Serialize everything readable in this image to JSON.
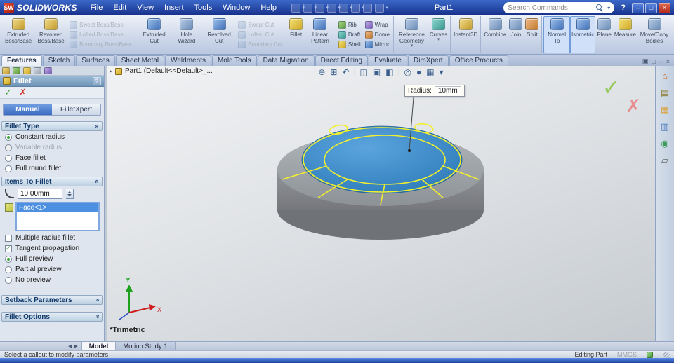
{
  "colors": {
    "tb1": "#3b68c8",
    "tb2": "#17308a",
    "ribbon1": "#eef2f8",
    "ribbon2": "#b9c7e0",
    "tabbg": "#c0cce2",
    "pmh1": "#9cbcd6",
    "pmh2": "#6d93b6",
    "sel": "#4d8fe0",
    "vp1": "#f1f2f4",
    "vp2": "#c6cbd0",
    "model-blue": "#3387c7",
    "edge-yellow": "#f2ef2d",
    "model-gray": "#9aa0a5",
    "ok-green": "#86c440",
    "cancel-red": "#e87a7a",
    "strip1": "#5b8ee8",
    "strip2": "#1d3f9e"
  },
  "titlebar": {
    "app_name": "SOLIDWORKS",
    "menus": [
      "File",
      "Edit",
      "View",
      "Insert",
      "Tools",
      "Window",
      "Help"
    ],
    "doc_title": "Part1",
    "search_placeholder": "Search Commands",
    "help_icon": "?",
    "window_icons": {
      "minimize": "–",
      "maximize": "□",
      "close": "×"
    }
  },
  "ribbon": {
    "groups": [
      {
        "buttons": [
          {
            "label": "Extruded Boss/Base"
          },
          {
            "label": "Revolved Boss/Base"
          },
          {
            "label": "Swept Boss/Base"
          },
          {
            "label": "Lofted Boss/Base"
          },
          {
            "label": "Boundary Boss/Base"
          }
        ]
      },
      {
        "buttons": [
          {
            "label": "Extruded Cut"
          },
          {
            "label": "Hole Wizard"
          },
          {
            "label": "Revolved Cut"
          },
          {
            "label": "Swept Cut"
          },
          {
            "label": "Lofted Cut"
          },
          {
            "label": "Boundary Cut"
          }
        ]
      },
      {
        "buttons": [
          {
            "label": "Fillet"
          },
          {
            "label": "Linear Pattern"
          },
          {
            "label": "Rib"
          },
          {
            "label": "Draft"
          },
          {
            "label": "Shell"
          },
          {
            "label": "Wrap"
          },
          {
            "label": "Dome"
          },
          {
            "label": "Mirror"
          }
        ]
      },
      {
        "buttons": [
          {
            "label": "Reference Geometry"
          },
          {
            "label": "Curves"
          }
        ]
      },
      {
        "buttons": [
          {
            "label": "Instant3D"
          }
        ]
      },
      {
        "buttons": [
          {
            "label": "Combine"
          },
          {
            "label": "Join"
          },
          {
            "label": "Split"
          }
        ]
      },
      {
        "buttons": [
          {
            "label": "Normal To"
          },
          {
            "label": "Isometric"
          },
          {
            "label": "Plane"
          },
          {
            "label": "Measure"
          },
          {
            "label": "Move/Copy Bodies"
          }
        ]
      }
    ]
  },
  "tabs": {
    "items": [
      "Features",
      "Sketch",
      "Surfaces",
      "Sheet Metal",
      "Weldments",
      "Mold Tools",
      "Data Migration",
      "Direct Editing",
      "Evaluate",
      "DimXpert",
      "Office Products"
    ],
    "active": "Features",
    "window_glyphs": [
      "▣",
      "□",
      "–",
      "×"
    ]
  },
  "pm": {
    "title": "Fillet",
    "help_icon": "?",
    "ok_icon": "✓",
    "cancel_icon": "✗",
    "mode_tabs": [
      "Manual",
      "FilletXpert"
    ],
    "active_mode": "Manual",
    "fillet_type": {
      "header": "Fillet Type",
      "options": [
        {
          "label": "Constant radius",
          "selected": true
        },
        {
          "label": "Variable radius",
          "disabled": true
        },
        {
          "label": "Face fillet"
        },
        {
          "label": "Full round fillet"
        }
      ]
    },
    "items_to_fillet": {
      "header": "Items To Fillet",
      "radius_value": "10.00mm",
      "selection": [
        "Face<1>"
      ],
      "checkboxes": [
        {
          "label": "Multiple radius fillet",
          "checked": false
        },
        {
          "label": "Tangent propagation",
          "checked": true,
          "glyph": "✓"
        }
      ],
      "preview_options": [
        {
          "label": "Full preview",
          "selected": true
        },
        {
          "label": "Partial preview"
        },
        {
          "label": "No preview"
        }
      ]
    },
    "setback_header": "Setback Parameters",
    "options_header": "Fillet Options"
  },
  "viewport": {
    "tree_label": "Part1 (Default<<Default>_...",
    "headsup_glyphs": [
      "⊕",
      "⊞",
      "↶",
      "◫",
      "▣",
      "◧",
      "◎",
      "●",
      "▦",
      "▾"
    ],
    "callout": {
      "label": "Radius:",
      "value": "10mm"
    },
    "view_name": "*Trimetric",
    "triad": {
      "x": "X",
      "y": "Y"
    },
    "confirm_ok": "✓",
    "confirm_cancel": "✗"
  },
  "taskpane": {
    "glyphs": [
      "⌂",
      "▤",
      "▦",
      "▥",
      "◉",
      "▱"
    ]
  },
  "bottom_tabs": {
    "items": [
      "Model",
      "Motion Study 1"
    ],
    "active": "Model",
    "scroll_left": "◀",
    "scroll_right": "▶"
  },
  "statusbar": {
    "message": "Select a callout to modify parameters",
    "editing": "Editing Part",
    "units": "MMGS"
  }
}
